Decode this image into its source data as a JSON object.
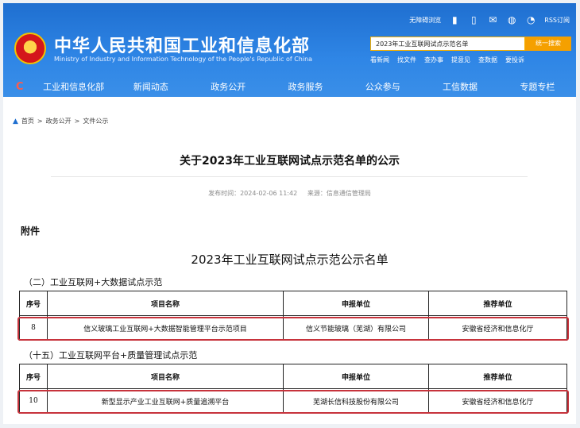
{
  "header": {
    "site_title": "中华人民共和国工业和信息化部",
    "site_sub": "Ministry of Industry and Information Technology of the People's Republic of China",
    "toplinks": {
      "accessible": "无障碍浏览",
      "rss": "RSS订阅"
    },
    "search": {
      "value": "2023年工业互联网试点示范名单",
      "button": "统一搜索"
    },
    "quick": [
      "看新闻",
      "找文件",
      "查办事",
      "提意见",
      "查数据",
      "要投诉"
    ]
  },
  "nav": {
    "logo": "C",
    "items": [
      "工业和信息化部",
      "新闻动态",
      "政务公开",
      "政务服务",
      "公众参与",
      "工信数据",
      "专题专栏"
    ]
  },
  "breadcrumb": [
    "首页",
    ">",
    "政务公开",
    ">",
    "文件公示"
  ],
  "article": {
    "title": "关于2023年工业互联网试点示范名单的公示",
    "meta_time": "发布时间：2024-02-06 11:42",
    "meta_source": "来源：信息通信管理局",
    "attachment": "附件",
    "list_title": "2023年工业互联网试点示范公示名单"
  },
  "sections": [
    {
      "heading": "（二）工业互联网+大数据试点示范",
      "headers": [
        "序号",
        "项目名称",
        "申报单位",
        "推荐单位"
      ],
      "row": [
        "8",
        "信义玻璃工业互联网+大数据智能管理平台示范项目",
        "信义节能玻璃（芜湖）有限公司",
        "安徽省经济和信息化厅"
      ]
    },
    {
      "heading": "（十五）工业互联网平台+质量管理试点示范",
      "headers": [
        "序号",
        "项目名称",
        "申报单位",
        "推荐单位"
      ],
      "row": [
        "10",
        "新型显示产业工业互联网+质量追溯平台",
        "芜湖长信科技股份有限公司",
        "安徽省经济和信息化厅"
      ]
    }
  ]
}
